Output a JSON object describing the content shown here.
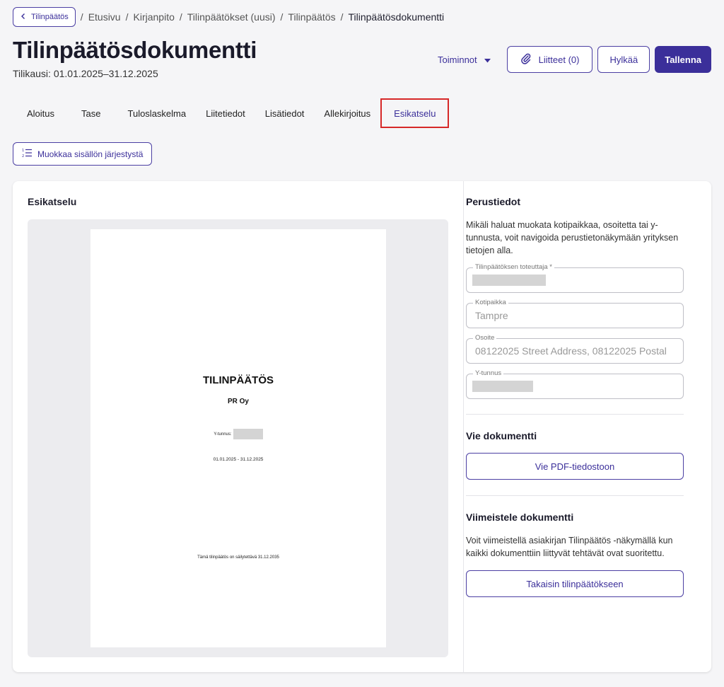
{
  "breadcrumb": {
    "back_label": "Tilinpäätös",
    "items": [
      "Etusivu",
      "Kirjanpito",
      "Tilinpäätökset (uusi)",
      "Tilinpäätös"
    ],
    "current": "Tilinpäätösdokumentti",
    "separator": "/"
  },
  "header": {
    "title": "Tilinpäätösdokumentti",
    "subtitle": "Tilikausi: 01.01.2025–31.12.2025"
  },
  "actions": {
    "toiminnot_label": "Toiminnot",
    "attachments_label": "Liitteet (0)",
    "reject_label": "Hylkää",
    "save_label": "Tallenna"
  },
  "tabs": [
    {
      "label": "Aloitus",
      "active": false
    },
    {
      "label": "Tase",
      "active": false
    },
    {
      "label": "Tuloslaskelma",
      "active": false
    },
    {
      "label": "Liitetiedot",
      "active": false
    },
    {
      "label": "Lisätiedot",
      "active": false
    },
    {
      "label": "Allekirjoitus",
      "active": false
    },
    {
      "label": "Esikatselu",
      "active": true
    }
  ],
  "reorder_button_label": "Muokkaa sisällön järjestystä",
  "preview": {
    "heading": "Esikatselu",
    "document": {
      "title": "TILINPÄÄTÖS",
      "company": "PR Oy",
      "ytunnus_label": "Y-tunnus:",
      "period": "01.01.2025 - 31.12.2025",
      "retention": "Tämä tilinpäätös on säilytettävä 31.12.2035"
    }
  },
  "basic_info": {
    "heading": "Perustiedot",
    "description": "Mikäli haluat muokata kotipaikkaa, osoitetta tai y-tunnusta, voit navigoida perustietonäkymään yrityksen tietojen alla.",
    "fields": {
      "preparer_label": "Tilinpäätöksen toteuttaja *",
      "domicile_label": "Kotipaikka",
      "domicile_value": "Tampre",
      "address_label": "Osoite",
      "address_value": "08122025 Street Address, 08122025 Postal",
      "business_id_label": "Y-tunnus"
    }
  },
  "export": {
    "heading": "Vie dokumentti",
    "button_label": "Vie PDF-tiedostoon"
  },
  "finalize": {
    "heading": "Viimeistele dokumentti",
    "description": "Voit viimeistellä asiakirjan Tilinpäätös -näkymällä kun kaikki dokumenttiin liittyvät tehtävät ovat suoritettu.",
    "button_label": "Takaisin tilinpäätökseen"
  },
  "colors": {
    "accent": "#3b2f9a",
    "active_tab_outline": "#d62828",
    "background": "#f5f5f7"
  }
}
